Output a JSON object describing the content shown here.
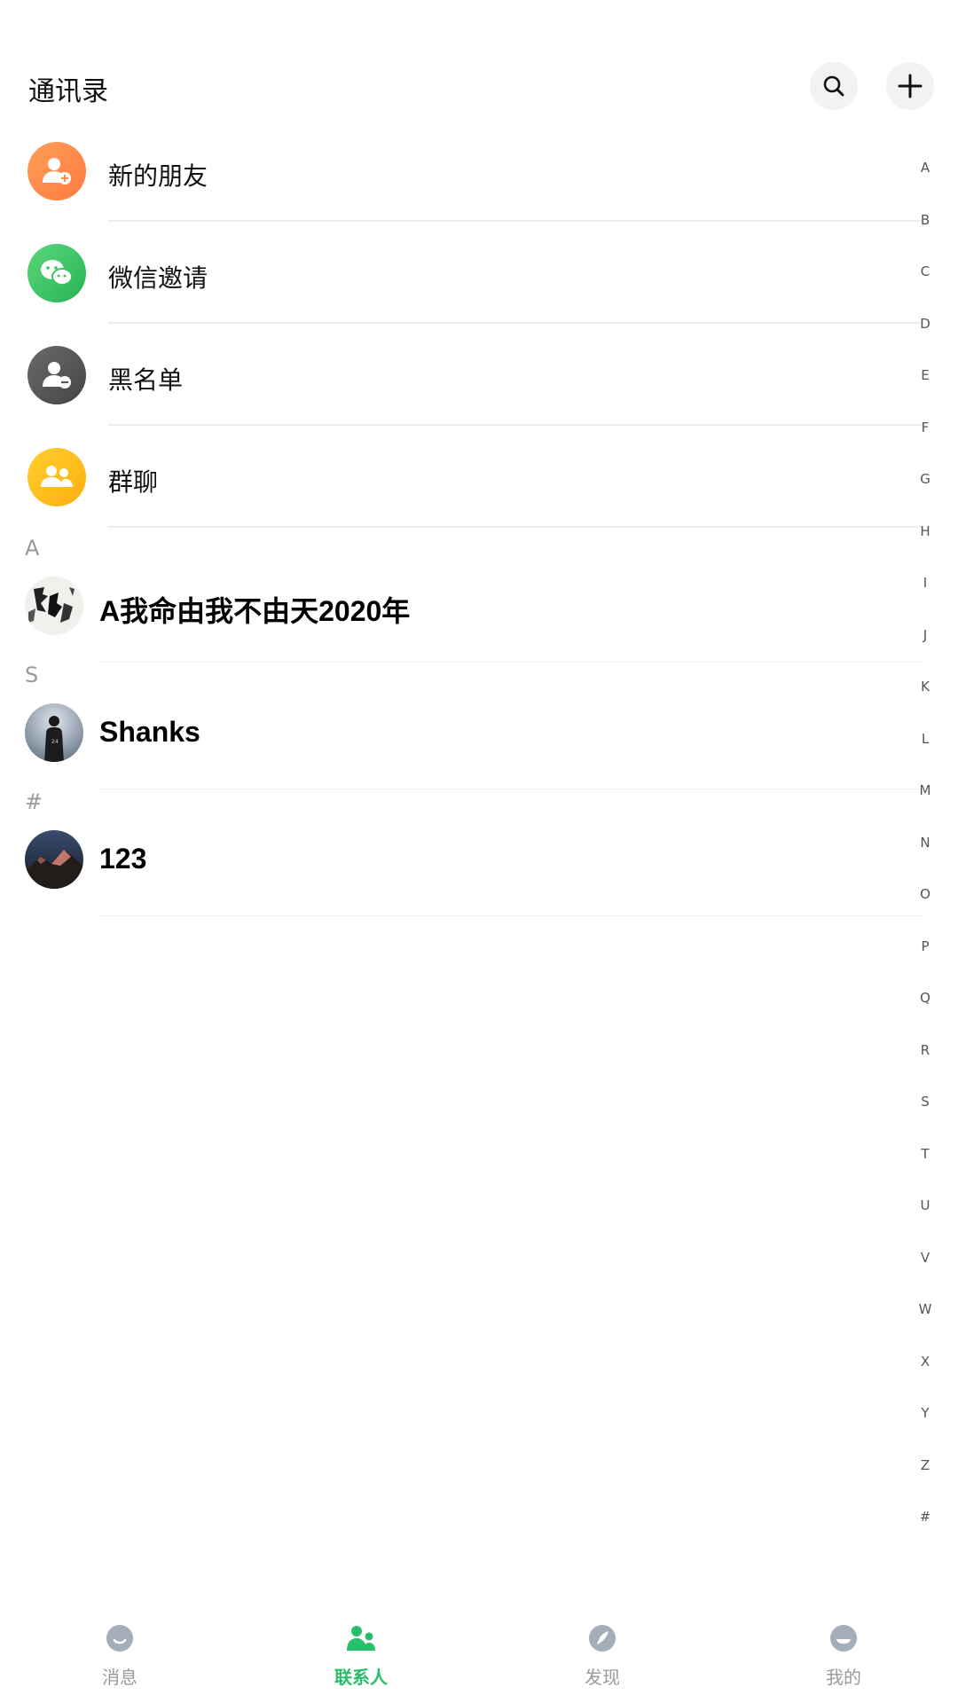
{
  "header": {
    "title": "通讯录",
    "search_icon": "search-icon",
    "add_icon": "plus-icon"
  },
  "fixed_items": [
    {
      "label": "新的朋友",
      "icon": "add-user-icon",
      "color": "#ff8a48"
    },
    {
      "label": "微信邀请",
      "icon": "wechat-icon",
      "color": "#39c463"
    },
    {
      "label": "黑名单",
      "icon": "block-user-icon",
      "color": "#555555"
    },
    {
      "label": "群聊",
      "icon": "group-icon",
      "color": "#ffbd1f"
    }
  ],
  "sections": [
    {
      "letter": "A",
      "contacts": [
        {
          "name": "A我命由我不由天2020年"
        }
      ]
    },
    {
      "letter": "S",
      "contacts": [
        {
          "name": "Shanks"
        }
      ]
    },
    {
      "letter": "#",
      "contacts": [
        {
          "name": "123"
        }
      ]
    }
  ],
  "index_bar": [
    "A",
    "B",
    "C",
    "D",
    "E",
    "F",
    "G",
    "H",
    "I",
    "J",
    "K",
    "L",
    "M",
    "N",
    "O",
    "P",
    "Q",
    "R",
    "S",
    "T",
    "U",
    "V",
    "W",
    "X",
    "Y",
    "Z",
    "#"
  ],
  "tabbar": {
    "accent_color": "#27c06a",
    "tabs": [
      {
        "label": "消息",
        "icon": "message-icon",
        "active": false
      },
      {
        "label": "联系人",
        "icon": "contacts-icon",
        "active": true
      },
      {
        "label": "发现",
        "icon": "discover-icon",
        "active": false
      },
      {
        "label": "我的",
        "icon": "profile-icon",
        "active": false
      }
    ]
  }
}
